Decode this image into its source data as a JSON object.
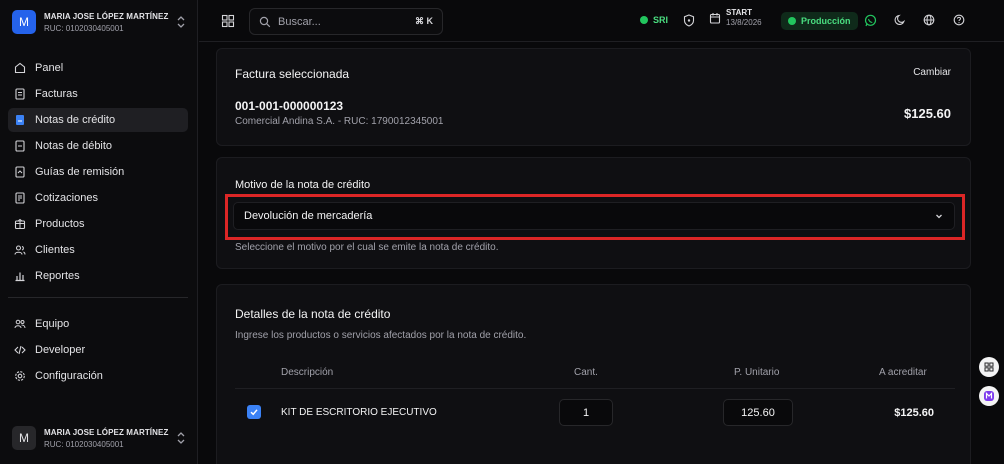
{
  "user": {
    "initial": "M",
    "name": "MARIA JOSE LÓPEZ MARTÍNEZ",
    "ruc": "RUC: 0102030405001"
  },
  "sidebar": {
    "items": [
      {
        "label": "Panel",
        "icon": "panel-icon"
      },
      {
        "label": "Facturas",
        "icon": "invoice-icon"
      },
      {
        "label": "Notas de crédito",
        "icon": "credit-note-icon",
        "active": true
      },
      {
        "label": "Notas de débito",
        "icon": "debit-note-icon"
      },
      {
        "label": "Guías de remisión",
        "icon": "shipping-guide-icon"
      },
      {
        "label": "Cotizaciones",
        "icon": "quote-icon"
      },
      {
        "label": "Productos",
        "icon": "box-icon"
      },
      {
        "label": "Clientes",
        "icon": "users-icon"
      },
      {
        "label": "Reportes",
        "icon": "chart-icon"
      }
    ],
    "items2": [
      {
        "label": "Equipo",
        "icon": "team-icon"
      },
      {
        "label": "Developer",
        "icon": "code-icon"
      },
      {
        "label": "Configuración",
        "icon": "settings-icon"
      }
    ]
  },
  "topbar": {
    "search_placeholder": "Buscar...",
    "shortcut": "⌘ K",
    "sri_label": "SRI",
    "plan_label": "START",
    "plan_date": "13/8/2026",
    "env_label": "Producción"
  },
  "invoice": {
    "title": "Factura seleccionada",
    "change": "Cambiar",
    "number": "001-001-000000123",
    "client": "Comercial Andina S.A. - RUC: 1790012345001",
    "total": "$125.60"
  },
  "reason": {
    "label": "Motivo de la nota de crédito",
    "value": "Devolución de mercadería",
    "help": "Seleccione el motivo por el cual se emite la nota de crédito."
  },
  "details": {
    "title": "Detalles de la nota de crédito",
    "subtitle": "Ingrese los productos o servicios afectados por la nota de crédito.",
    "columns": {
      "desc": "Descripción",
      "qty": "Cant.",
      "price": "P. Unitario",
      "credit": "A acreditar"
    },
    "rows": [
      {
        "checked": true,
        "desc": "KIT DE ESCRITORIO EJECUTIVO",
        "qty": "1",
        "price": "125.60",
        "credit": "$125.60"
      }
    ]
  },
  "colors": {
    "accent": "#2563eb",
    "success": "#22c55e",
    "highlight": "#dc2626"
  }
}
